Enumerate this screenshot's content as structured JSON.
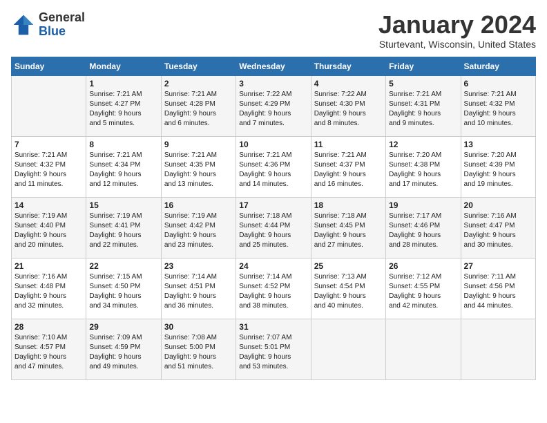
{
  "header": {
    "logo_general": "General",
    "logo_blue": "Blue",
    "month_title": "January 2024",
    "location": "Sturtevant, Wisconsin, United States"
  },
  "days_of_week": [
    "Sunday",
    "Monday",
    "Tuesday",
    "Wednesday",
    "Thursday",
    "Friday",
    "Saturday"
  ],
  "weeks": [
    [
      {
        "day": "",
        "info": ""
      },
      {
        "day": "1",
        "info": "Sunrise: 7:21 AM\nSunset: 4:27 PM\nDaylight: 9 hours\nand 5 minutes."
      },
      {
        "day": "2",
        "info": "Sunrise: 7:21 AM\nSunset: 4:28 PM\nDaylight: 9 hours\nand 6 minutes."
      },
      {
        "day": "3",
        "info": "Sunrise: 7:22 AM\nSunset: 4:29 PM\nDaylight: 9 hours\nand 7 minutes."
      },
      {
        "day": "4",
        "info": "Sunrise: 7:22 AM\nSunset: 4:30 PM\nDaylight: 9 hours\nand 8 minutes."
      },
      {
        "day": "5",
        "info": "Sunrise: 7:21 AM\nSunset: 4:31 PM\nDaylight: 9 hours\nand 9 minutes."
      },
      {
        "day": "6",
        "info": "Sunrise: 7:21 AM\nSunset: 4:32 PM\nDaylight: 9 hours\nand 10 minutes."
      }
    ],
    [
      {
        "day": "7",
        "info": "Sunrise: 7:21 AM\nSunset: 4:32 PM\nDaylight: 9 hours\nand 11 minutes."
      },
      {
        "day": "8",
        "info": "Sunrise: 7:21 AM\nSunset: 4:34 PM\nDaylight: 9 hours\nand 12 minutes."
      },
      {
        "day": "9",
        "info": "Sunrise: 7:21 AM\nSunset: 4:35 PM\nDaylight: 9 hours\nand 13 minutes."
      },
      {
        "day": "10",
        "info": "Sunrise: 7:21 AM\nSunset: 4:36 PM\nDaylight: 9 hours\nand 14 minutes."
      },
      {
        "day": "11",
        "info": "Sunrise: 7:21 AM\nSunset: 4:37 PM\nDaylight: 9 hours\nand 16 minutes."
      },
      {
        "day": "12",
        "info": "Sunrise: 7:20 AM\nSunset: 4:38 PM\nDaylight: 9 hours\nand 17 minutes."
      },
      {
        "day": "13",
        "info": "Sunrise: 7:20 AM\nSunset: 4:39 PM\nDaylight: 9 hours\nand 19 minutes."
      }
    ],
    [
      {
        "day": "14",
        "info": "Sunrise: 7:19 AM\nSunset: 4:40 PM\nDaylight: 9 hours\nand 20 minutes."
      },
      {
        "day": "15",
        "info": "Sunrise: 7:19 AM\nSunset: 4:41 PM\nDaylight: 9 hours\nand 22 minutes."
      },
      {
        "day": "16",
        "info": "Sunrise: 7:19 AM\nSunset: 4:42 PM\nDaylight: 9 hours\nand 23 minutes."
      },
      {
        "day": "17",
        "info": "Sunrise: 7:18 AM\nSunset: 4:44 PM\nDaylight: 9 hours\nand 25 minutes."
      },
      {
        "day": "18",
        "info": "Sunrise: 7:18 AM\nSunset: 4:45 PM\nDaylight: 9 hours\nand 27 minutes."
      },
      {
        "day": "19",
        "info": "Sunrise: 7:17 AM\nSunset: 4:46 PM\nDaylight: 9 hours\nand 28 minutes."
      },
      {
        "day": "20",
        "info": "Sunrise: 7:16 AM\nSunset: 4:47 PM\nDaylight: 9 hours\nand 30 minutes."
      }
    ],
    [
      {
        "day": "21",
        "info": "Sunrise: 7:16 AM\nSunset: 4:48 PM\nDaylight: 9 hours\nand 32 minutes."
      },
      {
        "day": "22",
        "info": "Sunrise: 7:15 AM\nSunset: 4:50 PM\nDaylight: 9 hours\nand 34 minutes."
      },
      {
        "day": "23",
        "info": "Sunrise: 7:14 AM\nSunset: 4:51 PM\nDaylight: 9 hours\nand 36 minutes."
      },
      {
        "day": "24",
        "info": "Sunrise: 7:14 AM\nSunset: 4:52 PM\nDaylight: 9 hours\nand 38 minutes."
      },
      {
        "day": "25",
        "info": "Sunrise: 7:13 AM\nSunset: 4:54 PM\nDaylight: 9 hours\nand 40 minutes."
      },
      {
        "day": "26",
        "info": "Sunrise: 7:12 AM\nSunset: 4:55 PM\nDaylight: 9 hours\nand 42 minutes."
      },
      {
        "day": "27",
        "info": "Sunrise: 7:11 AM\nSunset: 4:56 PM\nDaylight: 9 hours\nand 44 minutes."
      }
    ],
    [
      {
        "day": "28",
        "info": "Sunrise: 7:10 AM\nSunset: 4:57 PM\nDaylight: 9 hours\nand 47 minutes."
      },
      {
        "day": "29",
        "info": "Sunrise: 7:09 AM\nSunset: 4:59 PM\nDaylight: 9 hours\nand 49 minutes."
      },
      {
        "day": "30",
        "info": "Sunrise: 7:08 AM\nSunset: 5:00 PM\nDaylight: 9 hours\nand 51 minutes."
      },
      {
        "day": "31",
        "info": "Sunrise: 7:07 AM\nSunset: 5:01 PM\nDaylight: 9 hours\nand 53 minutes."
      },
      {
        "day": "",
        "info": ""
      },
      {
        "day": "",
        "info": ""
      },
      {
        "day": "",
        "info": ""
      }
    ]
  ]
}
